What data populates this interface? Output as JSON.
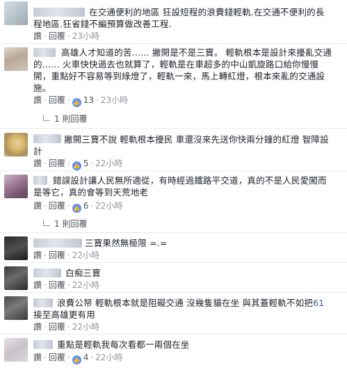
{
  "comments": [
    {
      "text": "在交通便利的地區 狂設短程的浪費錢輕軌.在交通不便利的長程地區.狂省錢不編預算做改善工程.",
      "actions": {
        "like": "讚",
        "reply": "回覆",
        "time": "23小時"
      }
    },
    {
      "text": "高雄人才知道的苦...... 撇開是不是三寶。 輕軌根本是設計來擾亂交通的...... 火車快快過去也就算了，輕軌是在車超多的中山凱旋路口給你慢慢開，重點好不容易等到綠燈了，輕軌一來，馬上轉紅燈，根本來亂的交通設施。",
      "actions": {
        "like": "讚",
        "reply": "回覆",
        "likes": "13",
        "time": "23小時"
      },
      "replies": "1 則回覆"
    },
    {
      "text": "撇開三寶不說 輕軌根本擾民 車還沒來先送你快兩分鐘的紅燈 智障設計",
      "actions": {
        "like": "讚",
        "reply": "回覆",
        "likes": "5",
        "time": "22小時"
      }
    },
    {
      "text": "錯誤設計讓人民無所適從，有時經過鐵路平交道，真的不是人民愛闖而是等它，真的會等到天荒地老",
      "actions": {
        "like": "讚",
        "reply": "回覆",
        "likes": "6",
        "time": "22小時"
      },
      "replies": "1 則回覆"
    },
    {
      "text": "三寶果然無極限 =.=",
      "actions": {
        "like": "讚",
        "reply": "回覆",
        "time": "22小時"
      }
    },
    {
      "text": "白痴三寶",
      "actions": {
        "like": "讚",
        "reply": "回覆",
        "time": "22小時"
      }
    },
    {
      "text_before": "浪費公帑 輕軌根本就是阻礙交通 沒幾隻貓在坐 與其蓋輕軌不如把",
      "text_num": "61",
      "text_after": "接至高雄更有用",
      "actions": {
        "like": "讚",
        "reply": "回覆",
        "time": "22小時"
      }
    },
    {
      "text": "重點是輕軌我每次看都一兩個在坐",
      "actions": {
        "like": "讚",
        "reply": "回覆",
        "likes": "4",
        "time": "22小時"
      }
    }
  ],
  "colors": {
    "like_badge": "#5890ff",
    "meta_text": "#90949c",
    "link": "#3b5998"
  },
  "icons": {
    "like": "thumbs-up-icon",
    "reply_thread": "reply-arrow-icon"
  }
}
